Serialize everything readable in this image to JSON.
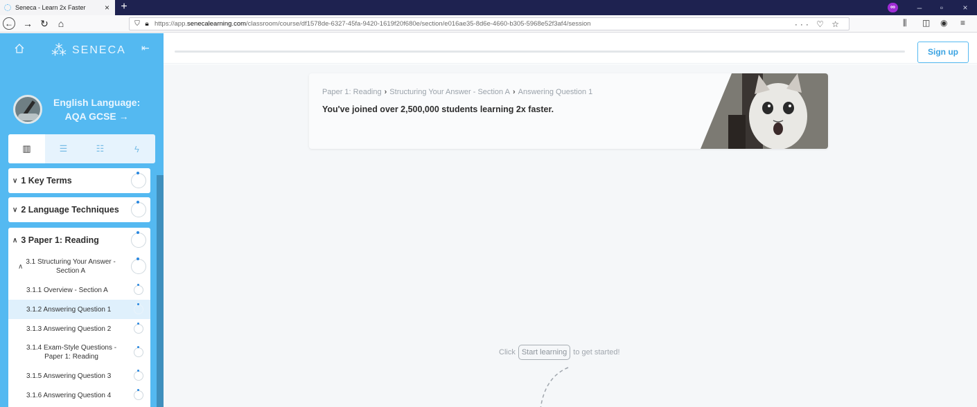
{
  "browser": {
    "tab_title": "Seneca - Learn 2x Faster",
    "tab_close": "×",
    "new_tab": "+",
    "private_badge": "∞",
    "url_prefix": "https://app.",
    "url_domain": "senecalearning.com",
    "url_path": "/classroom/course/df1578de-6327-45fa-9420-1619f20f680e/section/e016ae35-8d6e-4660-b305-5968e52f3af4/session",
    "url_actions": "··· ♡ ☆",
    "minimize": "–",
    "restore": "▫",
    "close": "×",
    "colors": {
      "tabbar": "#1e2250",
      "private": "#9f2cd5"
    }
  },
  "app": {
    "logo_text": "SENECA",
    "course_title_line1": "English Language:",
    "course_title_line2": "AQA GCSE →",
    "signup_label": "Sign up",
    "progress_fraction": 0.0,
    "accent_color": "#54b9f1",
    "sidebar_tabs": [
      {
        "icon": "books-icon",
        "glyph": "▥"
      },
      {
        "icon": "notebook-icon",
        "glyph": "☰"
      },
      {
        "icon": "document-icon",
        "glyph": "☷"
      },
      {
        "icon": "lightning-icon",
        "glyph": "ϟ"
      }
    ],
    "sections": [
      {
        "label": "1 Key Terms",
        "expanded": false
      },
      {
        "label": "2 Language Techniques",
        "expanded": false
      },
      {
        "label": "3 Paper 1: Reading",
        "expanded": true
      }
    ],
    "subsection": {
      "label_line1": "3.1 Structuring Your Answer -",
      "label_line2": "Section A"
    },
    "items": [
      {
        "label": "3.1.1 Overview - Section A"
      },
      {
        "label": "3.1.2 Answering Question 1",
        "selected": true
      },
      {
        "label": "3.1.3 Answering Question 2"
      },
      {
        "label_line1": "3.1.4 Exam-Style Questions -",
        "label_line2": "Paper 1: Reading"
      },
      {
        "label": "3.1.5 Answering Question 3"
      },
      {
        "label": "3.1.6 Answering Question 4"
      }
    ],
    "banner": {
      "crumb1": "Paper 1: Reading",
      "crumb2": "Structuring Your Answer - Section A",
      "crumb3": "Answering Question 1",
      "separator": "›",
      "message": "You've joined over 2,500,000 students learning 2x faster."
    },
    "hint": {
      "before": "Click",
      "button": "Start learning",
      "after": "to get started!"
    }
  }
}
